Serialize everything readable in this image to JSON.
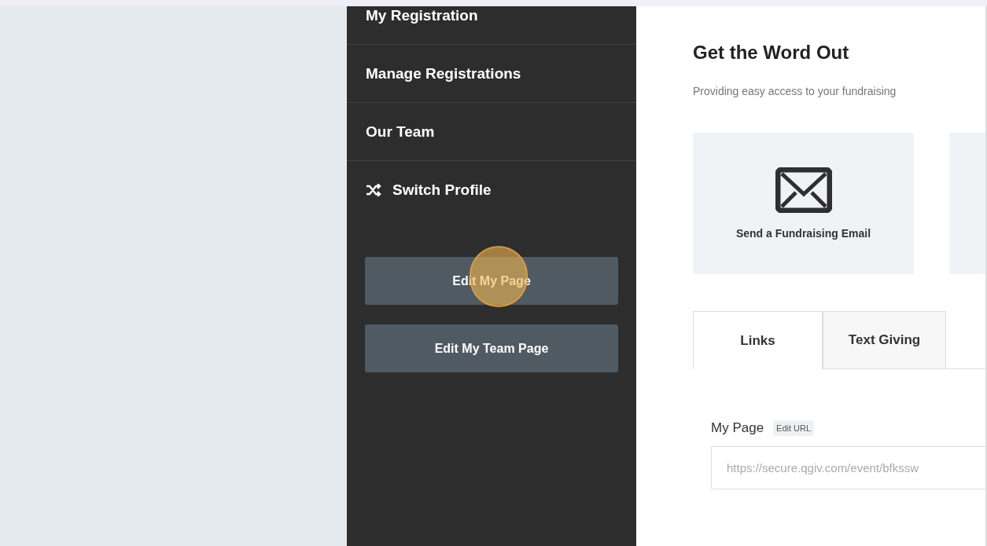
{
  "sidebar": {
    "items": [
      {
        "label": "My Registration",
        "kind": "link"
      },
      {
        "label": "Manage Registrations",
        "kind": "link"
      },
      {
        "label": "Our Team",
        "kind": "link"
      },
      {
        "label": "Switch Profile",
        "kind": "switch"
      }
    ],
    "buttons": [
      {
        "label": "Edit My Page",
        "clicked": true
      },
      {
        "label": "Edit My Team Page",
        "clicked": false
      }
    ]
  },
  "content": {
    "title": "Get the Word Out",
    "subtitle": "Providing easy access to your fundraising",
    "cards": [
      {
        "label": "Send a Fundraising Email",
        "kind": "email"
      },
      {
        "kind": "blank"
      }
    ],
    "tabs": [
      {
        "label": "Links",
        "selected": true
      },
      {
        "label": "Text Giving",
        "selected": false
      }
    ],
    "field": {
      "label": "My Page",
      "badge": "Edit URL",
      "value": "https://secure.qgiv.com/event/bfkssw"
    }
  }
}
